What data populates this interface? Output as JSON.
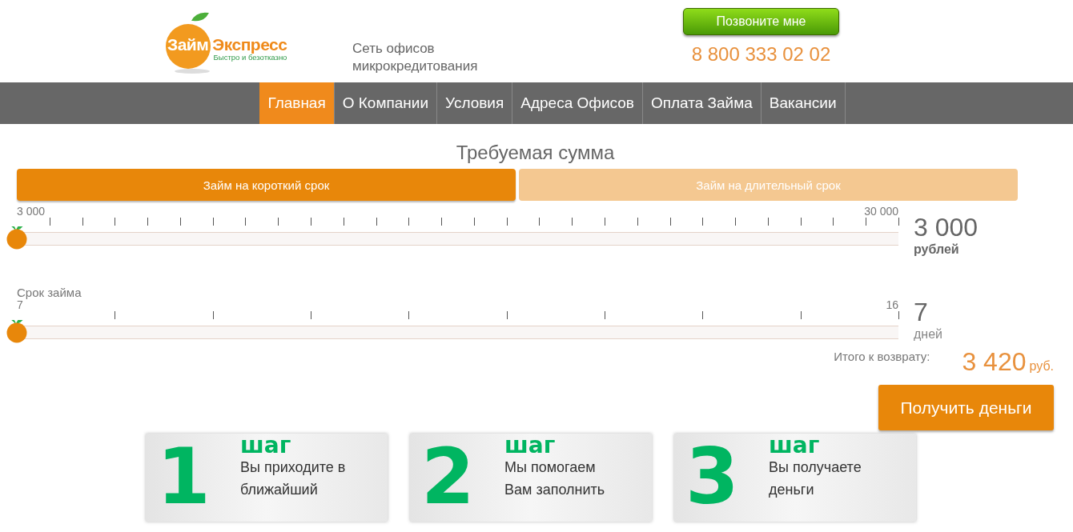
{
  "header": {
    "logo": {
      "word1": "Займ",
      "word2": "Экспресс",
      "slogan": "Быстро и безотказно"
    },
    "tagline": "Сеть офисов микрокредитования",
    "call_button": "Позвоните мне",
    "phone": "8 800 333 02 02"
  },
  "nav": [
    {
      "label": "Главная",
      "selected": true
    },
    {
      "label": "О Компании",
      "selected": false
    },
    {
      "label": "Условия",
      "selected": false
    },
    {
      "label": "Адреса Офисов",
      "selected": false
    },
    {
      "label": "Оплата Займа",
      "selected": false
    },
    {
      "label": "Вакансии",
      "selected": false
    }
  ],
  "calculator": {
    "title": "Требуемая сумма",
    "loan_tabs": [
      {
        "label": "Займ на короткий срок",
        "selected": true
      },
      {
        "label": "Займ на длительный срок",
        "selected": false
      }
    ],
    "sliders": [
      {
        "kind": "amount",
        "min": "3 000",
        "max": "30 000",
        "level": 0,
        "value": "3 000",
        "unit": "рублей"
      },
      {
        "kind": "term",
        "label": "Срок займа",
        "min": "7",
        "max": "16",
        "level": 0,
        "value": "7",
        "unit": "дней"
      }
    ],
    "total_label": "Итого к возврату:",
    "total_value": "3 420",
    "total_currency": "руб.",
    "submit": "Получить деньги"
  },
  "steps": [
    {
      "number": "1",
      "word": "шаг",
      "text": "Вы приходите в ближайший"
    },
    {
      "number": "2",
      "word": "шаг",
      "text": "Мы помогаем Вам заполнить"
    },
    {
      "number": "3",
      "word": "шаг",
      "text": "Вы получаете деньги"
    }
  ]
}
